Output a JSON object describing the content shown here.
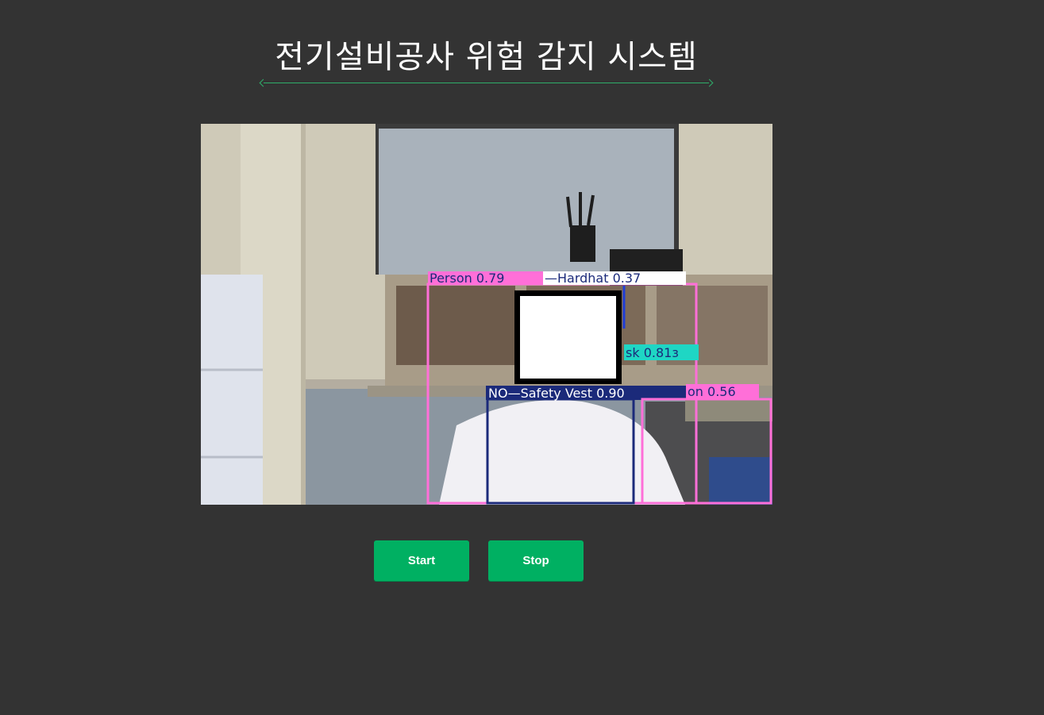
{
  "header": {
    "title": "전기설비공사 위험 감지 시스템"
  },
  "video": {
    "detections": [
      {
        "label": "Person 0.79",
        "color": "#ff6fd8"
      },
      {
        "label": "—Hardhat 0.37",
        "color": "#ffffff"
      },
      {
        "label": "sk 0.81з",
        "color": "#1fd6c4"
      },
      {
        "label": "NO—Safety Vest 0.90",
        "color": "#1b2a7a"
      },
      {
        "label": "on 0.56",
        "color": "#ff6fd8"
      }
    ]
  },
  "controls": {
    "start_label": "Start",
    "stop_label": "Stop"
  },
  "colors": {
    "background": "#333333",
    "accent": "#00b062"
  }
}
